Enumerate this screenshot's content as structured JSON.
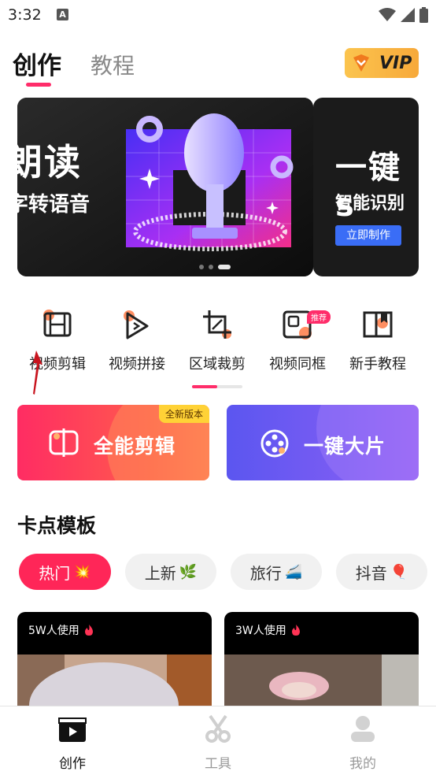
{
  "status_bar": {
    "time": "3:32"
  },
  "header": {
    "tabs": [
      {
        "label": "创作",
        "active": true
      },
      {
        "label": "教程",
        "active": false
      }
    ],
    "vip_label": "VIP"
  },
  "banner": {
    "main_title": "朗读",
    "main_subtitle": "字转语音",
    "side_title": "一键s",
    "side_subtitle": "智能识别",
    "side_button": "立即制作",
    "page_count": 3,
    "active_page": 3
  },
  "tools": [
    {
      "label": "视频剪辑",
      "icon": "film-icon"
    },
    {
      "label": "视频拼接",
      "icon": "play-join-icon"
    },
    {
      "label": "区域裁剪",
      "icon": "crop-icon"
    },
    {
      "label": "视频同框",
      "icon": "frame-icon",
      "badge": "推荐"
    },
    {
      "label": "新手教程",
      "icon": "book-icon"
    }
  ],
  "cards": {
    "edit": {
      "title": "全能剪辑",
      "badge": "全新版本"
    },
    "movie": {
      "title": "一键大片"
    }
  },
  "section": {
    "title": "卡点模板",
    "chips": [
      {
        "label": "热门",
        "emoji": "💥",
        "active": true
      },
      {
        "label": "上新",
        "emoji": "🌿",
        "active": false
      },
      {
        "label": "旅行",
        "emoji": "🚄",
        "active": false
      },
      {
        "label": "抖音",
        "emoji": "🎈",
        "active": false
      }
    ],
    "templates": [
      {
        "usage": "5W人使用"
      },
      {
        "usage": "3W人使用"
      }
    ]
  },
  "bottom_nav": [
    {
      "label": "创作",
      "icon": "clapperboard-icon",
      "active": true
    },
    {
      "label": "工具",
      "icon": "scissors-icon",
      "active": false
    },
    {
      "label": "我的",
      "icon": "user-icon",
      "active": false
    }
  ],
  "colors": {
    "accent": "#ff2d6a",
    "vip": "#f7a93a",
    "movie": "#6a59f1"
  }
}
